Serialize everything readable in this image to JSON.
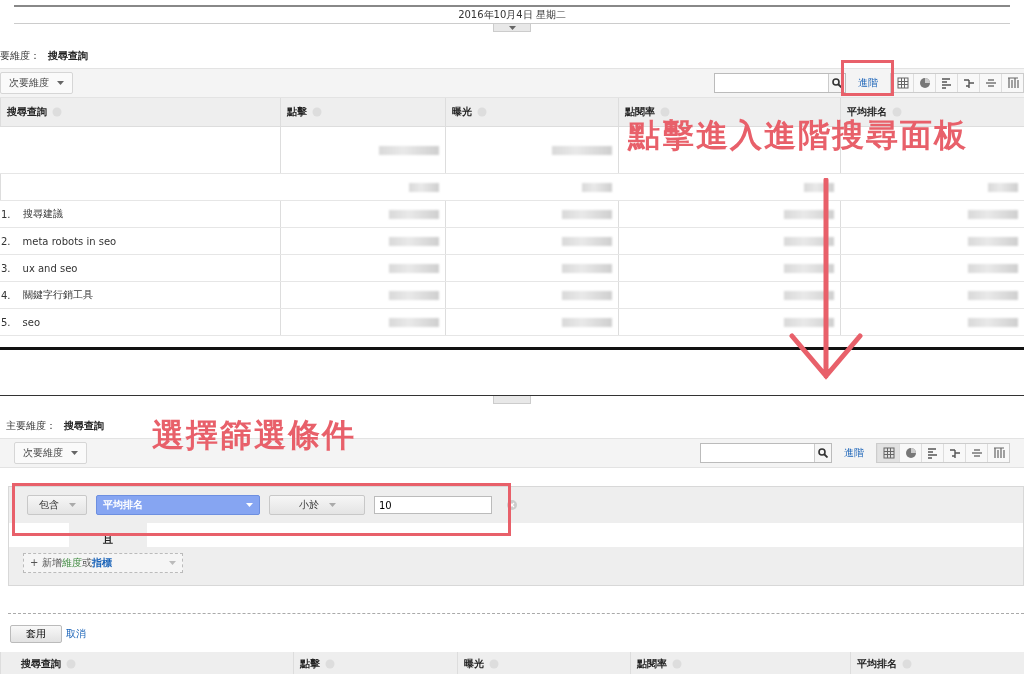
{
  "top_panel": {
    "date": "2016年10月4日 星期二",
    "primary_dimension": {
      "label": "要維度：",
      "value": "搜尋查詢"
    },
    "secondary_dimension": "次要維度",
    "advanced_link": "進階",
    "columns": [
      "搜尋查詢",
      "點擊",
      "曝光",
      "點閱率",
      "平均排名"
    ],
    "rows": [
      {
        "index": "1.",
        "query": "搜尋建議"
      },
      {
        "index": "2.",
        "query": "meta robots in seo"
      },
      {
        "index": "3.",
        "query": "ux and seo"
      },
      {
        "index": "4.",
        "query": "關鍵字行銷工具"
      },
      {
        "index": "5.",
        "query": "seo"
      }
    ]
  },
  "bottom_panel": {
    "primary_dimension": {
      "label": "主要維度：",
      "value": "搜尋查詢"
    },
    "secondary_dimension": "次要維度",
    "advanced_link": "進階",
    "filter": {
      "include": "包含",
      "metric": "平均排名",
      "operator": "小於",
      "value": "10",
      "joiner": "且",
      "add": {
        "prefix": "+ 新增",
        "dimension": "維度",
        "or": "或",
        "metric": "指標"
      }
    },
    "apply": "套用",
    "cancel": "取消",
    "columns": [
      "搜尋查詢",
      "點擊",
      "曝光",
      "點閱率",
      "平均排名"
    ]
  },
  "annotations": [
    {
      "text": "點擊進入進階搜尋面板"
    },
    {
      "text": "選擇篩選條件"
    }
  ]
}
